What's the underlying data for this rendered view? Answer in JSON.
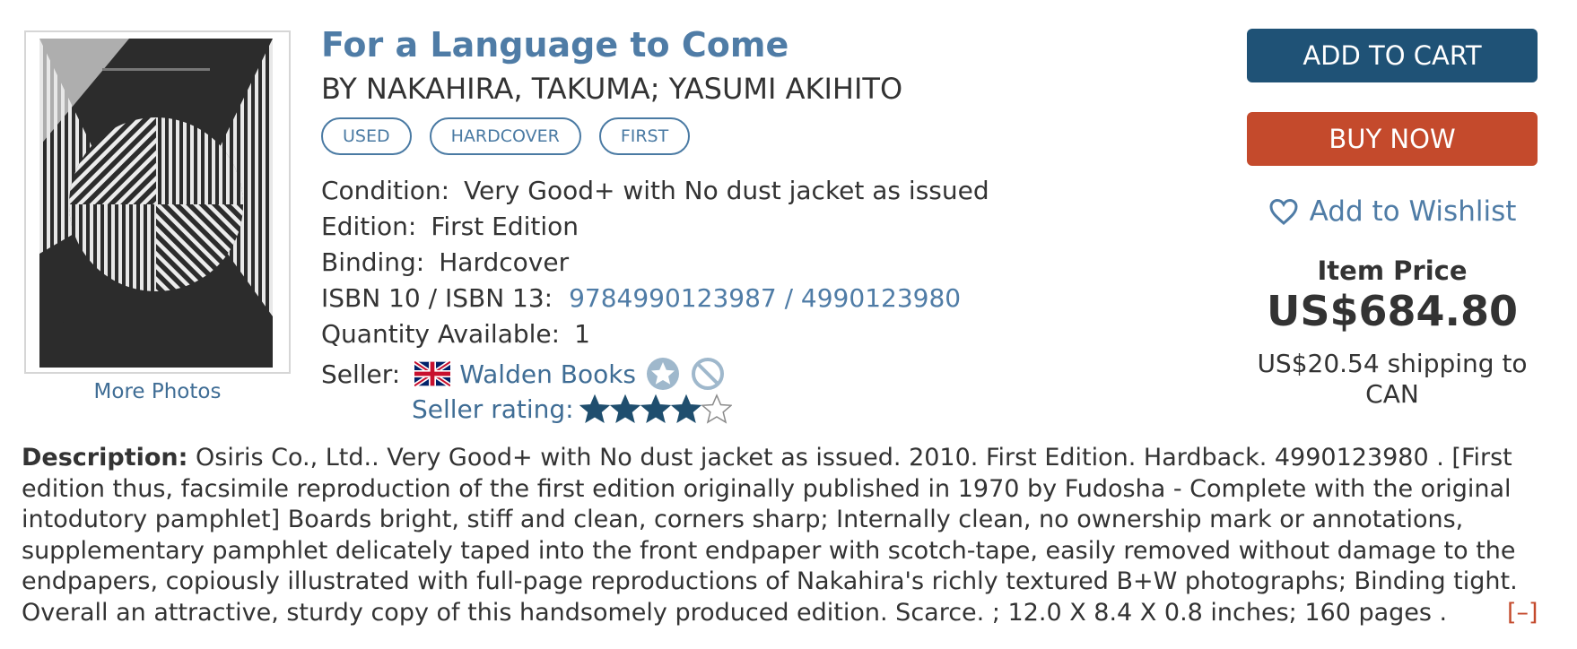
{
  "book": {
    "title": "For a Language to Come",
    "author": "BY NAKAHIRA, TAKUMA; YASUMI AKIHITO",
    "badges": [
      "USED",
      "HARDCOVER",
      "FIRST"
    ],
    "more_photos": "More Photos"
  },
  "details": {
    "condition_label": "Condition:",
    "condition_value": "Very Good+ with No dust jacket as issued",
    "edition_label": "Edition:",
    "edition_value": "First Edition",
    "binding_label": "Binding:",
    "binding_value": "Hardcover",
    "isbn_label": "ISBN 10 / ISBN 13:",
    "isbn_value": "9784990123987 / 4990123980",
    "quantity_label": "Quantity Available:",
    "quantity_value": "1",
    "seller_label": "Seller:",
    "seller_name": "Walden Books",
    "seller_rating_label": "Seller rating:",
    "seller_rating_stars": 4,
    "seller_rating_max": 5
  },
  "actions": {
    "add_to_cart": "ADD TO CART",
    "buy_now": "BUY NOW",
    "wishlist": "Add to Wishlist"
  },
  "price": {
    "label": "Item Price",
    "value": "US$684.80",
    "shipping_line1": "US$20.54 shipping to",
    "shipping_line2": "CAN"
  },
  "description": {
    "label": "Description:",
    "text": "Osiris Co., Ltd.. Very Good+ with No dust jacket as issued. 2010. First Edition. Hardback. 4990123980 . [First edition thus, facsimile reproduction of the first edition originally published in 1970 by Fudosha - Complete with the original intodutory pamphlet] Boards bright, stiff and clean, corners sharp; Internally clean, no ownership mark or annotations, supplementary pamphlet delicately taped into the front endpaper with scotch-tape, easily removed without damage to the endpapers, copiously illustrated with full-page reproductions of Nakahira's richly textured B+W photographs; Binding tight. Overall an attractive, sturdy copy of this handsomely produced edition. Scarce. ; 12.0 X 8.4 X 0.8 inches; 160 pages .",
    "collapse": "[–]"
  },
  "colors": {
    "link": "#4f7ca6",
    "add_to_cart": "#1f5276",
    "buy_now": "#c44a2c",
    "star_fill": "#1f4e6e"
  }
}
